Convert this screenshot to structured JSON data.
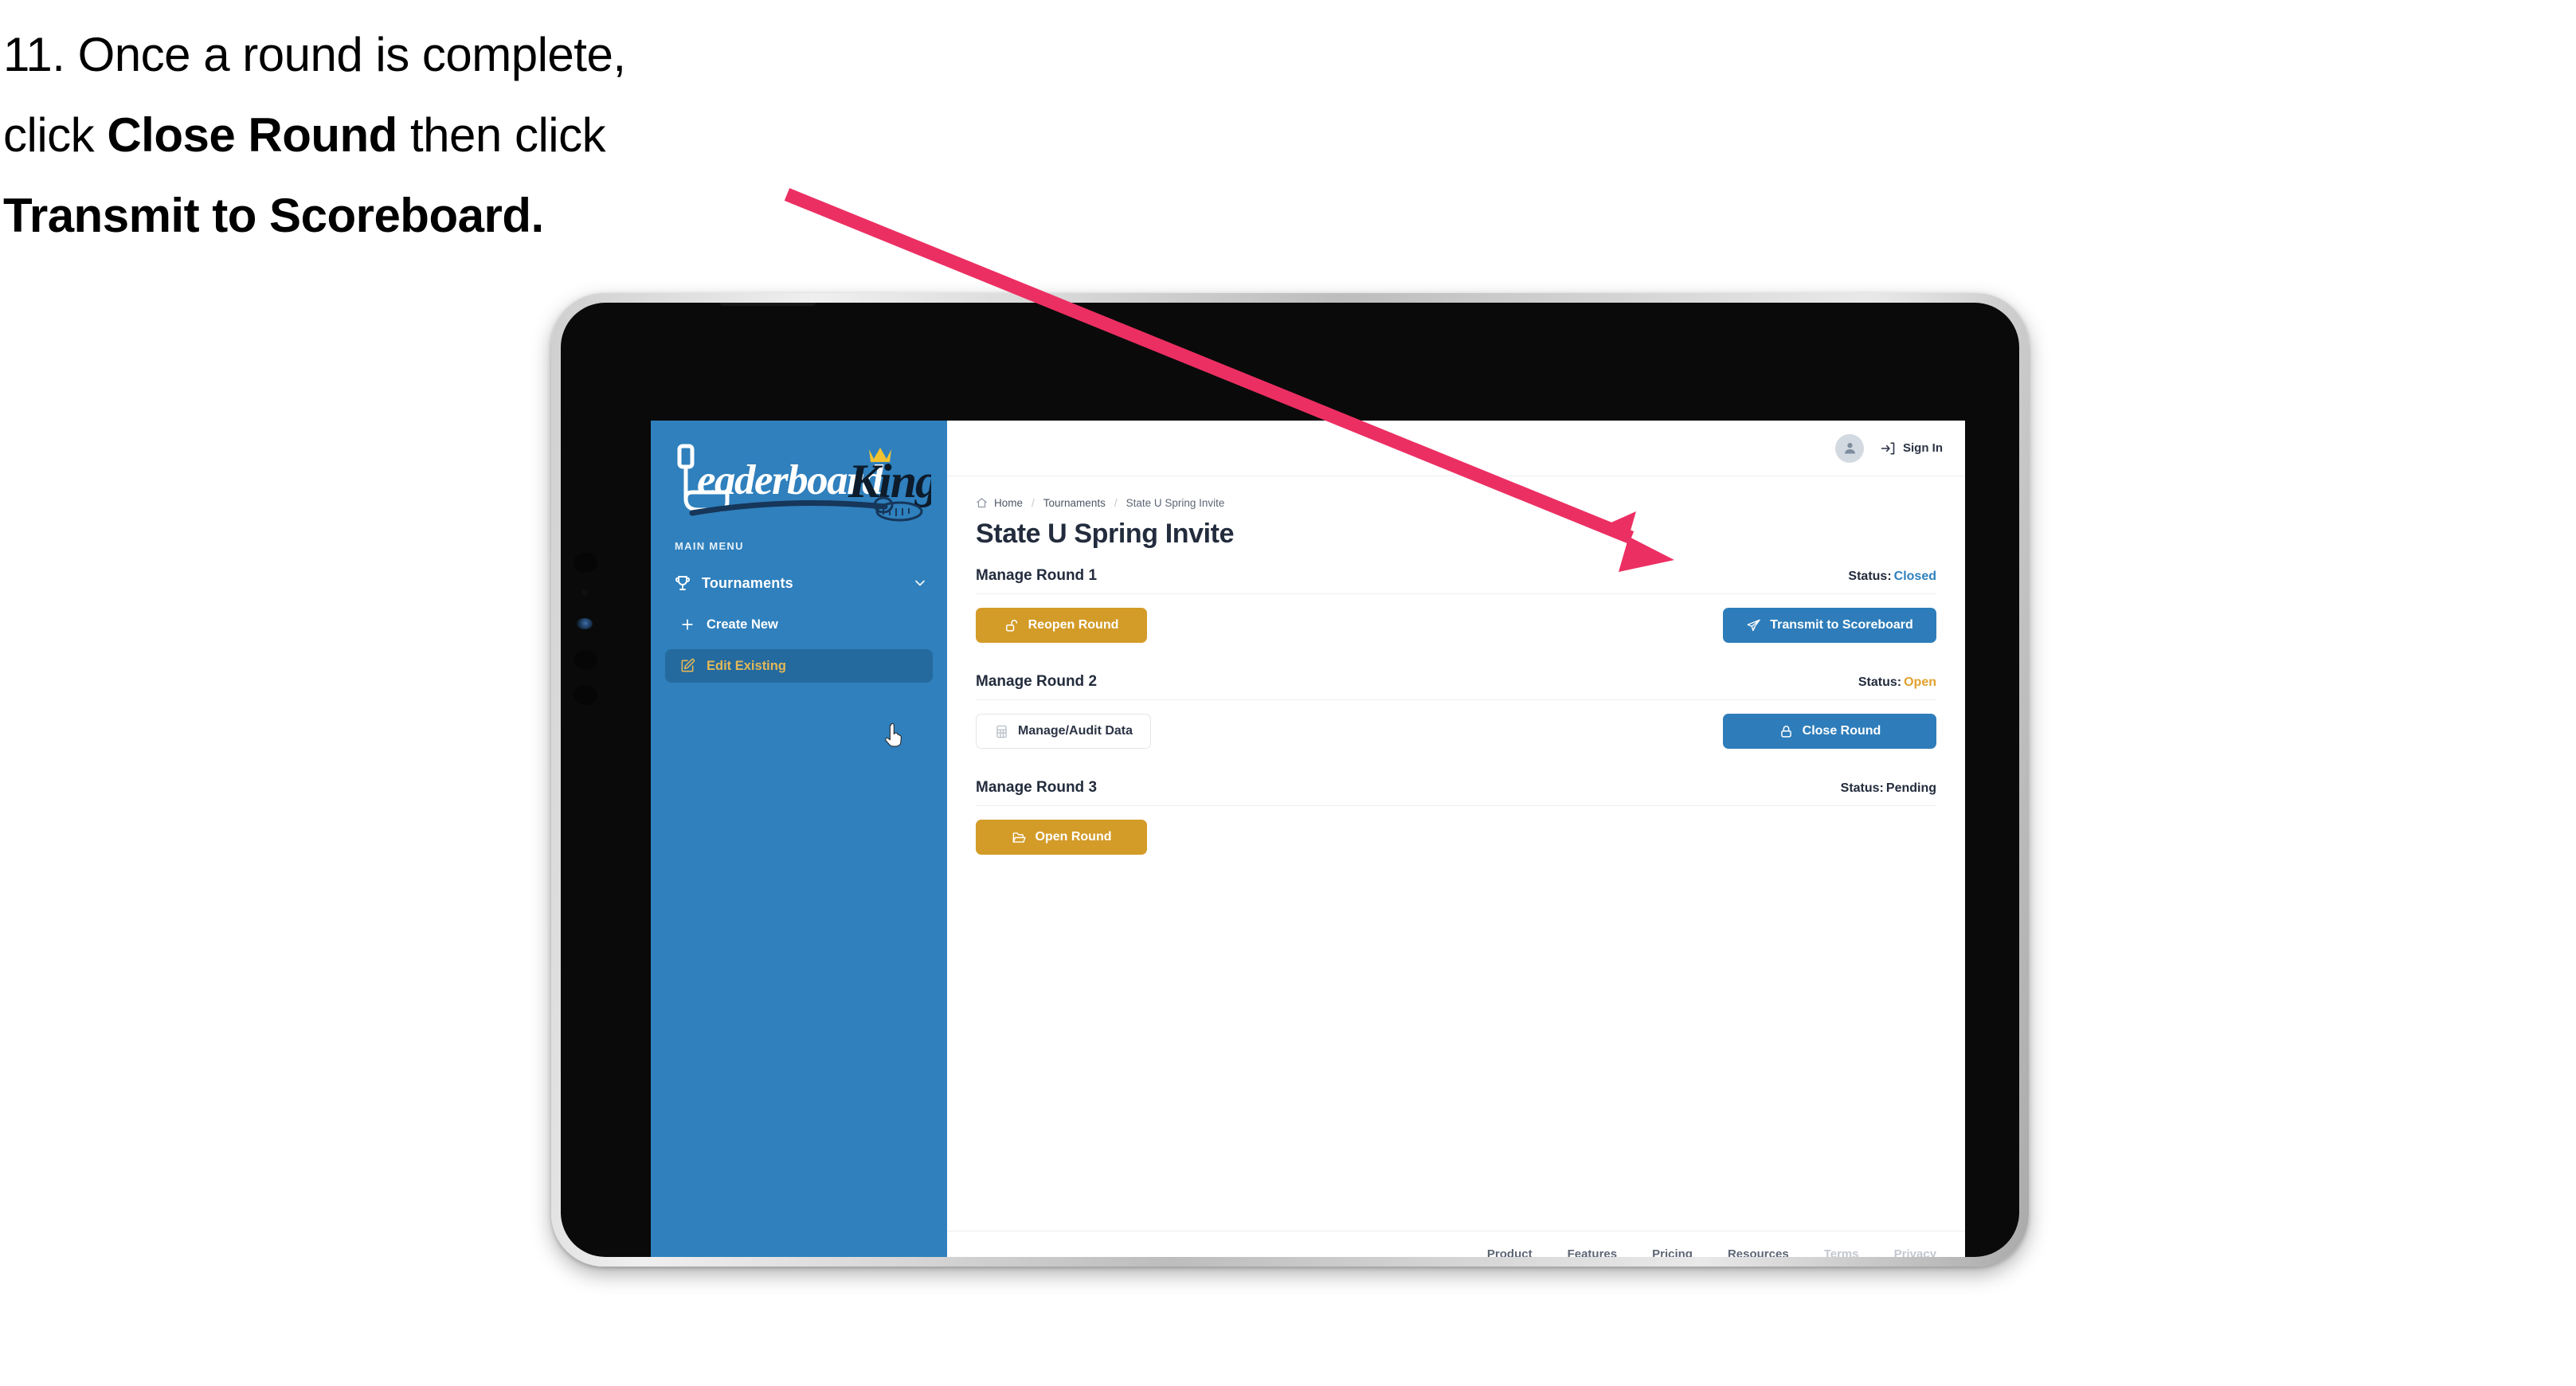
{
  "caption": {
    "line1_prefix": "11. Once a round is complete,",
    "line2_prefix": "click ",
    "line2_bold": "Close Round",
    "line2_suffix": " then click",
    "line3_bold": "Transmit to Scoreboard."
  },
  "colors": {
    "sidebar_blue": "#2F80BD",
    "sidebar_active": "#246A9E",
    "accent_gold": "#D39B28",
    "button_blue": "#2E7DBA",
    "status_open": "#E0A12C",
    "status_closed": "#2F80BD",
    "text_dark": "#232C3D",
    "annotation_pink": "#EC2F63"
  },
  "sidebar": {
    "logo_primary": "Leaderboard",
    "logo_secondary": "King",
    "logo_icon": "golf-club-icon",
    "menu_label": "MAIN MENU",
    "nav": {
      "title": "Tournaments",
      "icon": "trophy-icon",
      "chevron": "chevron-down-icon"
    },
    "items": [
      {
        "label": "Create New",
        "icon": "plus-icon",
        "active": false
      },
      {
        "label": "Edit Existing",
        "icon": "pencil-square-icon",
        "active": true
      }
    ]
  },
  "topbar": {
    "avatar_icon": "user-avatar-icon",
    "signin_label": "Sign In",
    "signin_icon": "sign-in-arrow-icon"
  },
  "breadcrumb": {
    "home_icon": "home-icon",
    "items": [
      "Home",
      "Tournaments",
      "State U Spring Invite"
    ],
    "separator": "/"
  },
  "page": {
    "title": "State U Spring Invite"
  },
  "rounds": [
    {
      "name": "Manage Round 1",
      "status_label": "Status:",
      "status_value": "Closed",
      "status_class": "closed",
      "left_button": {
        "label": "Reopen Round",
        "icon": "unlock-icon",
        "style": "gold"
      },
      "right_button": {
        "label": "Transmit to Scoreboard",
        "icon": "paper-plane-icon",
        "style": "blue"
      }
    },
    {
      "name": "Manage Round 2",
      "status_label": "Status:",
      "status_value": "Open",
      "status_class": "open",
      "left_button": {
        "label": "Manage/Audit Data",
        "icon": "table-grid-icon",
        "style": "ghost"
      },
      "right_button": {
        "label": "Close Round",
        "icon": "lock-icon",
        "style": "blue"
      }
    },
    {
      "name": "Manage Round 3",
      "status_label": "Status:",
      "status_value": "Pending",
      "status_class": "pending",
      "left_button": {
        "label": "Open Round",
        "icon": "folder-open-icon",
        "style": "gold"
      },
      "right_button": null
    }
  ],
  "footer": {
    "links": [
      {
        "label": "Product",
        "muted": false
      },
      {
        "label": "Features",
        "muted": false
      },
      {
        "label": "Pricing",
        "muted": false
      },
      {
        "label": "Resources",
        "muted": false
      },
      {
        "label": "Terms",
        "muted": true
      },
      {
        "label": "Privacy",
        "muted": true
      }
    ]
  },
  "cursor": {
    "icon": "pointing-hand-cursor"
  }
}
